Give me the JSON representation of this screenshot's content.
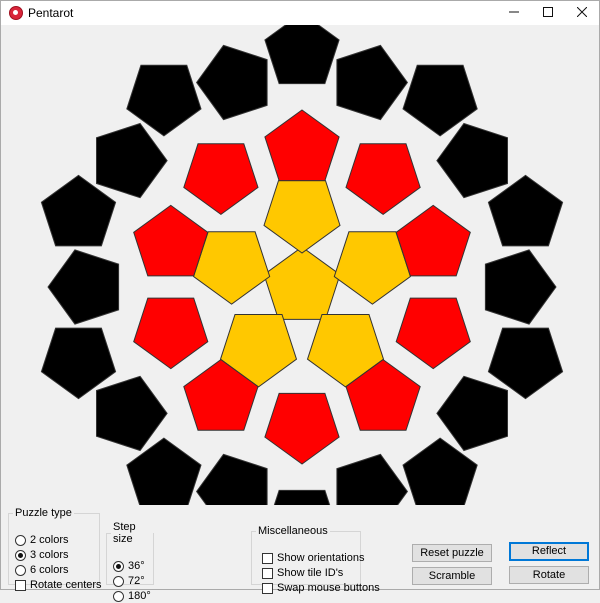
{
  "window": {
    "title": "Pentarot",
    "minimize_icon": "minimize-icon",
    "maximize_icon": "maximize-icon",
    "close_icon": "close-icon"
  },
  "colors": {
    "black": "#000000",
    "red": "#ff0000",
    "yellow": "#ffc800",
    "background": "#f0f0f0"
  },
  "puzzle": {
    "tiles": [
      {
        "ring": "center",
        "color": "yellow"
      },
      {
        "ring": "inner",
        "color": "yellow"
      },
      {
        "ring": "inner",
        "color": "yellow"
      },
      {
        "ring": "inner",
        "color": "yellow"
      },
      {
        "ring": "inner",
        "color": "yellow"
      },
      {
        "ring": "inner",
        "color": "yellow"
      },
      {
        "ring": "middle",
        "color": "red"
      },
      {
        "ring": "middle",
        "color": "red"
      },
      {
        "ring": "middle",
        "color": "red"
      },
      {
        "ring": "middle",
        "color": "red"
      },
      {
        "ring": "middle",
        "color": "red"
      },
      {
        "ring": "middle",
        "color": "red"
      },
      {
        "ring": "middle",
        "color": "red"
      },
      {
        "ring": "middle",
        "color": "red"
      },
      {
        "ring": "middle",
        "color": "red"
      },
      {
        "ring": "middle",
        "color": "red"
      },
      {
        "ring": "outer",
        "color": "black"
      },
      {
        "ring": "outer",
        "color": "black"
      },
      {
        "ring": "outer",
        "color": "black"
      },
      {
        "ring": "outer",
        "color": "black"
      },
      {
        "ring": "outer",
        "color": "black"
      },
      {
        "ring": "outer",
        "color": "black"
      },
      {
        "ring": "outer",
        "color": "black"
      },
      {
        "ring": "outer",
        "color": "black"
      },
      {
        "ring": "outer",
        "color": "black"
      },
      {
        "ring": "outer",
        "color": "black"
      },
      {
        "ring": "outer",
        "color": "black"
      },
      {
        "ring": "outer",
        "color": "black"
      },
      {
        "ring": "outer",
        "color": "black"
      },
      {
        "ring": "outer",
        "color": "black"
      },
      {
        "ring": "outer",
        "color": "black"
      },
      {
        "ring": "outer",
        "color": "black"
      },
      {
        "ring": "outer",
        "color": "black"
      },
      {
        "ring": "outer",
        "color": "black"
      },
      {
        "ring": "outer",
        "color": "black"
      },
      {
        "ring": "outer",
        "color": "black"
      }
    ]
  },
  "puzzle_type": {
    "label": "Puzzle type",
    "options": [
      "2 colors",
      "3 colors",
      "6 colors"
    ],
    "selected": "3 colors",
    "rotate_centers": {
      "label": "Rotate centers",
      "checked": false
    }
  },
  "step_size": {
    "label": "Step size",
    "options": [
      "36°",
      "72°",
      "180°"
    ],
    "selected": "36°"
  },
  "misc": {
    "label": "Miscellaneous",
    "show_orientations": {
      "label": "Show orientations",
      "checked": false
    },
    "show_tile_ids": {
      "label": "Show tile ID's",
      "checked": false
    },
    "swap_mouse_buttons": {
      "label": "Swap mouse buttons",
      "checked": false
    }
  },
  "buttons": {
    "reset": "Reset puzzle",
    "scramble": "Scramble",
    "reflect": "Reflect",
    "rotate": "Rotate"
  }
}
